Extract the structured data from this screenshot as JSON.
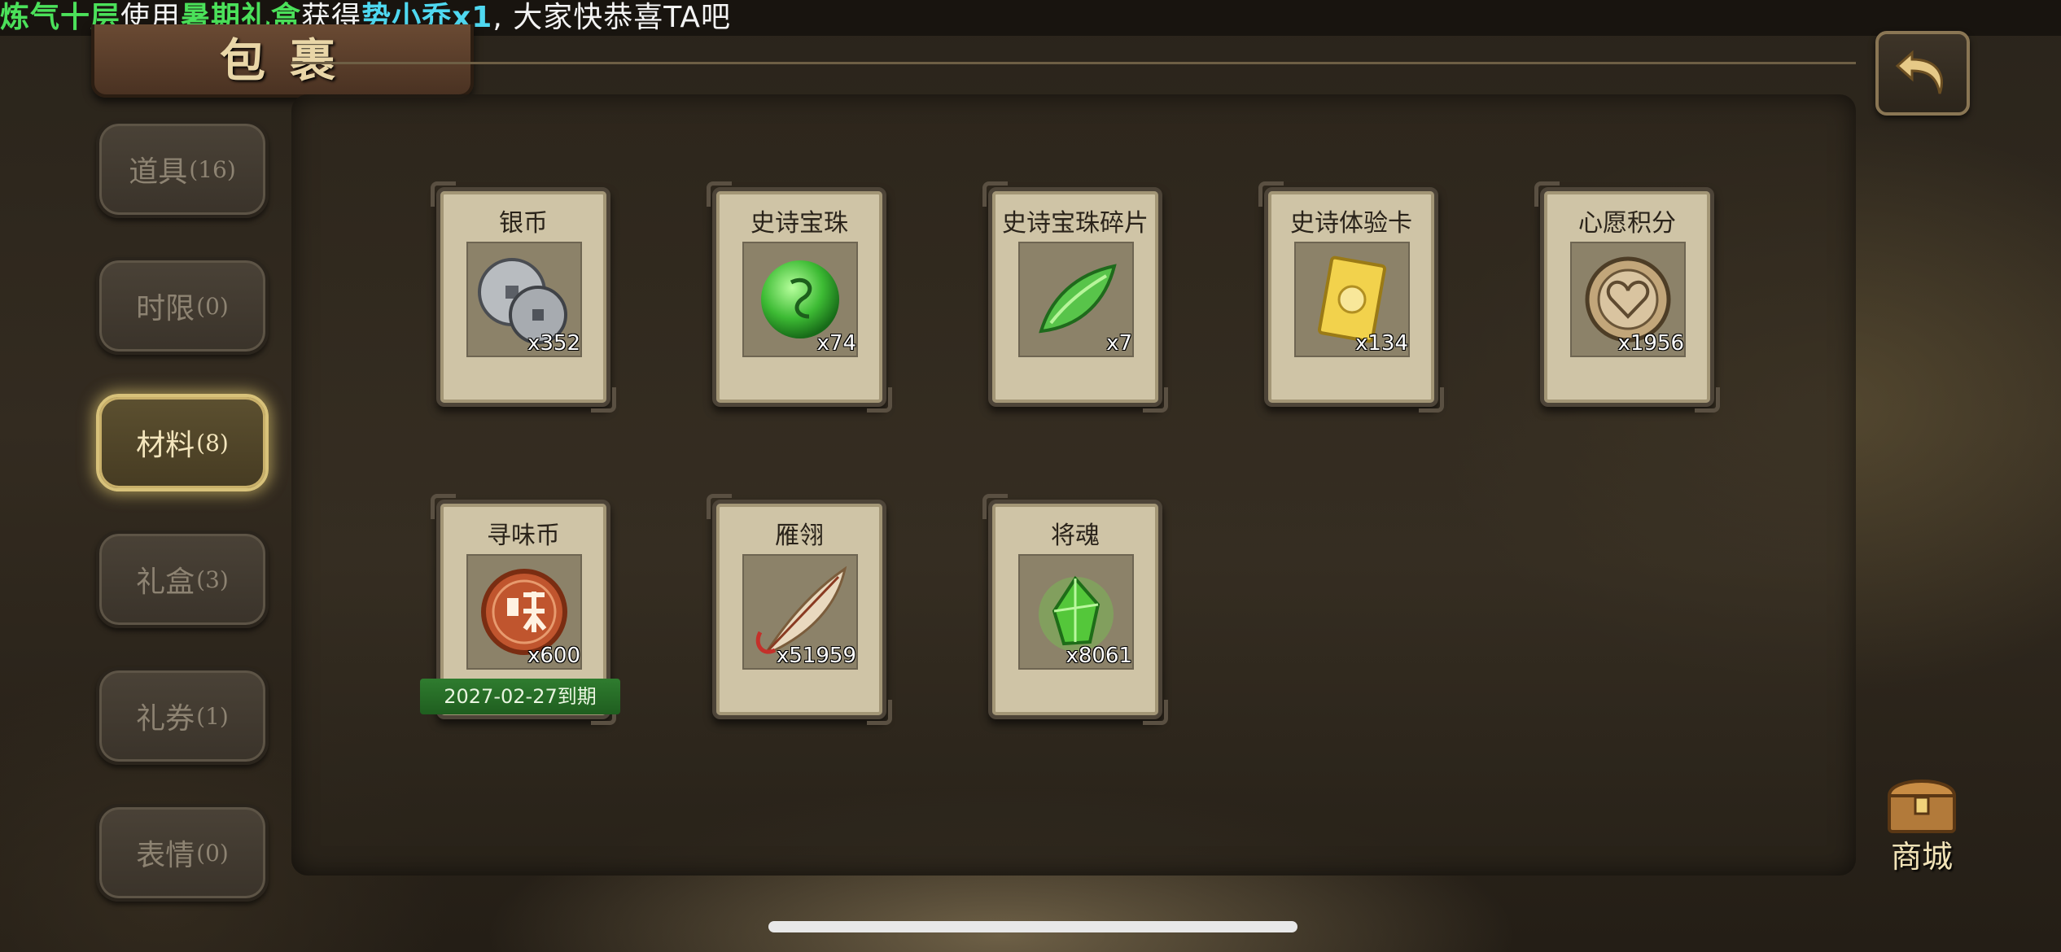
{
  "broadcast": {
    "part1": "炼气十层",
    "part2": "使用",
    "part3": "暑期礼盒",
    "part4": "获得",
    "part5": "势小乔x1",
    "part6": ", 大家快恭喜TA吧"
  },
  "header": {
    "title": "包裹"
  },
  "tabs": [
    {
      "label": "道具",
      "count": "(16)"
    },
    {
      "label": "时限",
      "count": "(0)"
    },
    {
      "label": "材料",
      "count": "(8)"
    },
    {
      "label": "礼盒",
      "count": "(3)"
    },
    {
      "label": "礼券",
      "count": "(1)"
    },
    {
      "label": "表情",
      "count": "(0)"
    }
  ],
  "active_tab": "材料",
  "items": [
    {
      "name": "银币",
      "qty": "x352",
      "icon": "silver-coin-icon"
    },
    {
      "name": "史诗宝珠",
      "qty": "x74",
      "icon": "epic-orb-icon"
    },
    {
      "name": "史诗宝珠碎片",
      "qty": "x7",
      "icon": "epic-orb-shard-icon"
    },
    {
      "name": "史诗体验卡",
      "qty": "x134",
      "icon": "epic-trial-card-icon"
    },
    {
      "name": "心愿积分",
      "qty": "x1956",
      "icon": "wish-points-coin-icon"
    },
    {
      "name": "寻味币",
      "qty": "x600",
      "icon": "flavor-coin-icon",
      "expire": "2027-02-27到期"
    },
    {
      "name": "雁翎",
      "qty": "x51959",
      "icon": "feather-icon"
    },
    {
      "name": "将魂",
      "qty": "x8061",
      "icon": "general-soul-crystal-icon"
    }
  ],
  "shop": {
    "label": "商城"
  },
  "colors": {
    "accent_green": "#4be15a",
    "accent_cyan": "#4fd8f0",
    "card_bg": "#cfc4a6",
    "active_tab_glow": "#d8c27a"
  }
}
